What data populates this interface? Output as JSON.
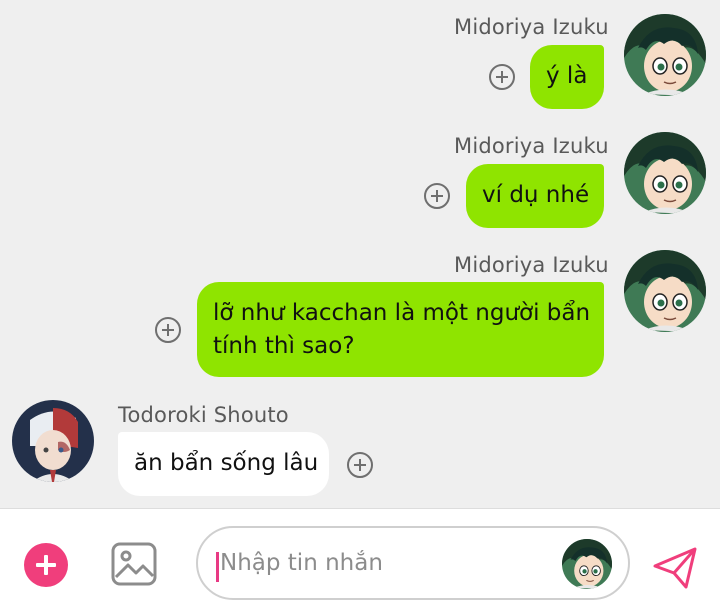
{
  "messages": [
    {
      "sender": "Midoriya Izuku",
      "text": "ý là",
      "direction": "outgoing",
      "avatar": "deku-avatar"
    },
    {
      "sender": "Midoriya Izuku",
      "text": "ví dụ nhé",
      "direction": "outgoing",
      "avatar": "deku-avatar"
    },
    {
      "sender": "Midoriya Izuku",
      "text_lines": [
        "lỡ như kacchan là một người bẩn",
        "tính thì sao?"
      ],
      "direction": "outgoing",
      "avatar": "deku-avatar"
    },
    {
      "sender": "Todoroki Shouto",
      "text": "ăn bẩn sống lâu",
      "direction": "incoming",
      "avatar": "todoroki-avatar"
    }
  ],
  "composer": {
    "placeholder": "Nhập tin nhắn",
    "value": ""
  },
  "icons": {
    "add": "plus-circle-icon",
    "image": "image-icon",
    "send": "paper-plane-icon",
    "react": "add-reaction-icon"
  },
  "colors": {
    "outgoing_bubble": "#8fe400",
    "incoming_bubble": "#ffffff",
    "accent": "#f03e7c",
    "background": "#efefef"
  }
}
